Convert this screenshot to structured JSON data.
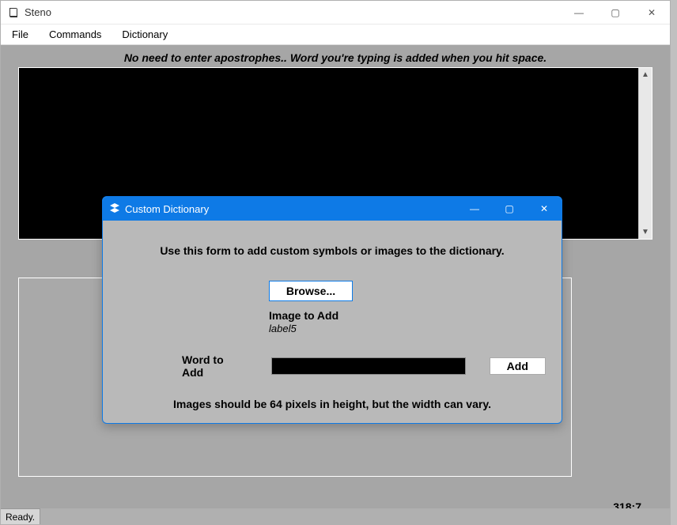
{
  "window": {
    "title": "Steno",
    "controls": {
      "min": "—",
      "max": "▢",
      "close": "✕"
    }
  },
  "menu": {
    "file": "File",
    "commands": "Commands",
    "dictionary": "Dictionary"
  },
  "hint": "No need to enter apostrophes.. Word you're typing is  added when you hit space.",
  "cursor_pos": "318:7",
  "status": "Ready.",
  "dialog": {
    "title": "Custom Dictionary",
    "controls": {
      "min": "—",
      "max": "▢",
      "close": "✕"
    },
    "heading": "Use this form to add custom symbols or images to the dictionary.",
    "browse": "Browse...",
    "image_label": "Image to Add",
    "label5": "label5",
    "word_label": "Word to Add",
    "word_value": "",
    "add": "Add",
    "footer": "Images should be 64 pixels in height, but the width can vary."
  }
}
